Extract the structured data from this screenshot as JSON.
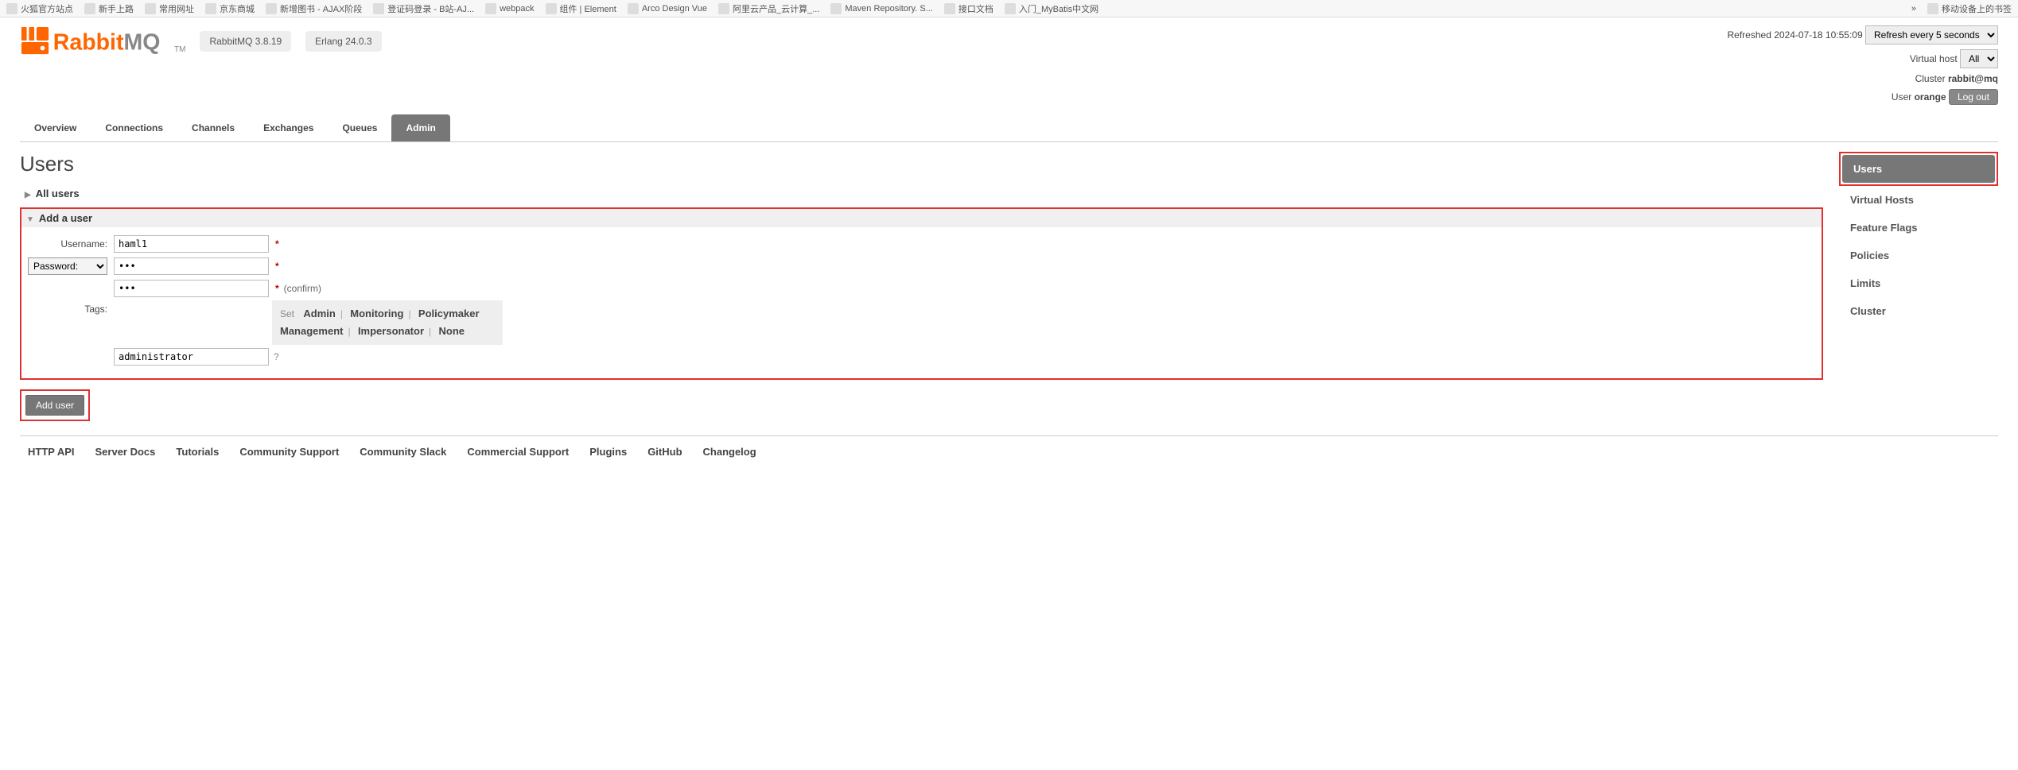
{
  "bookmarks": [
    "火狐官方站点",
    "新手上路",
    "常用网址",
    "京东商城",
    "新增图书 - AJAX阶段",
    "登证码登录 - B站-AJ...",
    "webpack",
    "组件 | Element",
    "Arco Design Vue",
    "阿里云产品_云计算_...",
    "Maven Repository. S...",
    "接口文档",
    "入门_MyBatis中文网",
    "移动设备上的书签"
  ],
  "logo_text": "RabbitMQ",
  "tm": "TM",
  "version_rabbit": "RabbitMQ 3.8.19",
  "version_erlang": "Erlang 24.0.3",
  "refreshed_label": "Refreshed",
  "refreshed_time": "2024-07-18 10:55:09",
  "refresh_option": "Refresh every 5 seconds",
  "vhost_label": "Virtual host",
  "vhost_selected": "All",
  "cluster_label": "Cluster",
  "cluster_value": "rabbit@mq",
  "user_label": "User",
  "user_value": "orange",
  "logout": "Log out",
  "tabs": [
    "Overview",
    "Connections",
    "Channels",
    "Exchanges",
    "Queues",
    "Admin"
  ],
  "active_tab": "Admin",
  "page_title": "Users",
  "section_all_users": "All users",
  "section_add_user": "Add a user",
  "form": {
    "username_label": "Username:",
    "username_value": "haml1",
    "password_label": "Password:",
    "password_value": "•••",
    "password_confirm_value": "•••",
    "confirm_label": "(confirm)",
    "tags_label": "Tags:",
    "tags_value": "administrator",
    "set_label": "Set",
    "tag_options": [
      "Admin",
      "Monitoring",
      "Policymaker",
      "Management",
      "Impersonator",
      "None"
    ],
    "q": "?",
    "star": "*"
  },
  "add_user_button": "Add user",
  "side_nav": [
    "Users",
    "Virtual Hosts",
    "Feature Flags",
    "Policies",
    "Limits",
    "Cluster"
  ],
  "active_side": "Users",
  "footer": [
    "HTTP API",
    "Server Docs",
    "Tutorials",
    "Community Support",
    "Community Slack",
    "Commercial Support",
    "Plugins",
    "GitHub",
    "Changelog"
  ]
}
